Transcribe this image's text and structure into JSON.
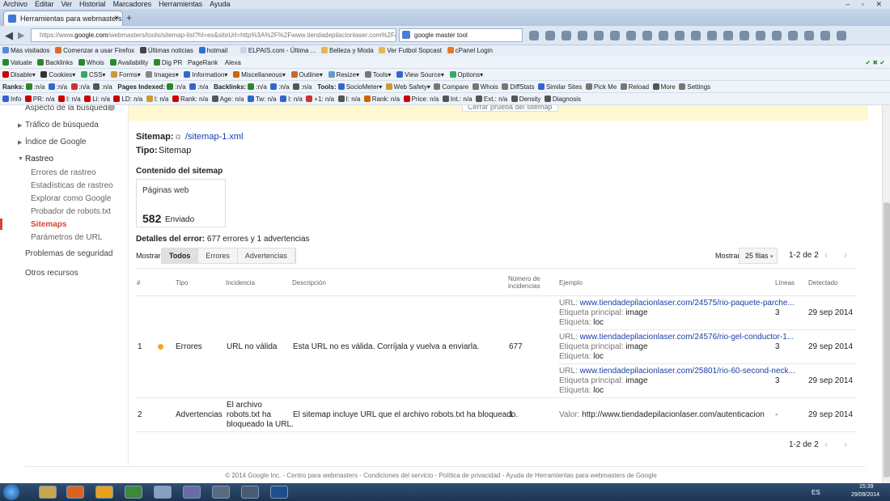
{
  "menubar": [
    "Archivo",
    "Editar",
    "Ver",
    "Historial",
    "Marcadores",
    "Herramientas",
    "Ayuda"
  ],
  "tab": {
    "title": "Herramientas para webmasters de ...",
    "close": "×",
    "new": "+"
  },
  "url": {
    "prefix": "https://www.",
    "host": "google.com",
    "path": "/webmasters/tools/sitemap-list?hl=es&siteUrl=http%3A%2F%2Fwww.tiendadepilacionlaser.com%2F#MA"
  },
  "search": {
    "value": "google master tool"
  },
  "bookmarks": [
    "Más visitados",
    "Comenzar a usar Firefox",
    "Últimas noticias",
    "hotmail",
    "ELPAIS.com - Última ...",
    "Belleza y Moda",
    "Ver Futbol Sopcast",
    "cPanel Login"
  ],
  "toolbar1": [
    "Valuate",
    "Backlinks",
    "Whois",
    "Availability",
    "Dig PR",
    "PageRank",
    "Alexa"
  ],
  "toolbar2": [
    "Disable",
    "Cookies",
    "CSS",
    "Forms",
    "Images",
    "Information",
    "Miscellaneous",
    "Outline",
    "Resize",
    "Tools",
    "View Source",
    "Options"
  ],
  "toolbar3": {
    "ranks": "Ranks:",
    "na": "n/a",
    "pages": "Pages Indexed:",
    "backlinks": "Backlinks:",
    "tools": "Tools:",
    "items": [
      "SocioMeter",
      "Web Safety",
      "Compare",
      "Whois",
      "DiffStats",
      "Similar Sites",
      "Pick Me",
      "Reload",
      "More",
      "Settings"
    ]
  },
  "toolbar4": [
    "Info",
    "PR: n/a",
    "I: n/a",
    "Li: n/a",
    "LD: n/a",
    "I: n/a",
    "Rank: n/a",
    "Age: n/a",
    "Tw: n/a",
    "I: n/a",
    "+1: n/a",
    "I: n/a",
    "Rank: n/a",
    "Price: n/a",
    "Int.: n/a",
    "Ext.: n/a",
    "Density",
    "Diagnosis"
  ],
  "banner": {
    "text": "Cerrar prueba del sitemap"
  },
  "sidebar": {
    "items": [
      {
        "label": "Aspecto de la búsqueda"
      },
      {
        "label": "Tráfico de búsqueda"
      },
      {
        "label": "Índice de Google"
      },
      {
        "label": "Rastreo"
      },
      {
        "label": "Errores de rastreo"
      },
      {
        "label": "Estadísticas de rastreo"
      },
      {
        "label": "Explorar como Google"
      },
      {
        "label": "Probador de robots.txt"
      },
      {
        "label": "Sitemaps"
      },
      {
        "label": "Parámetros de URL"
      },
      {
        "label": "Problemas de seguridad"
      },
      {
        "label": "Otros recursos"
      }
    ]
  },
  "main": {
    "sitemap_label": "Sitemap:",
    "sitemap_value": "/sitemap-1.xml",
    "tipo_label": "Tipo:",
    "tipo_value": "Sitemap",
    "contenido_title": "Contenido del sitemap",
    "paginas_label": "Páginas web",
    "enviado_count": "582",
    "enviado_label": "Enviado",
    "detalles_label": "Detalles del error:",
    "detalles_value": "677 errores y 1 advertencias",
    "mostrar": "Mostrar:",
    "filters": [
      "Todos",
      "Errores",
      "Advertencias"
    ],
    "mostrar_right": "Mostrar",
    "rows_per_page": "25 filas",
    "pagination": "1-2 de 2",
    "columns": [
      "#",
      "Tipo",
      "Incidencia",
      "Descripción",
      "Número de incidencias",
      "Ejemplo",
      "Líneas",
      "Detectado"
    ],
    "rows": [
      {
        "num": "1",
        "tipo": "Errores",
        "incidencia": "URL no válida",
        "descripcion": "Esta URL no es válida. Corríjala y vuelva a enviarla.",
        "numero": "677",
        "examples": [
          {
            "url": "www.tiendadepilacionlaser.com/24575/rio-paquete-parche...",
            "etiqueta": "image",
            "etiqueta2": "loc",
            "lineas": "3",
            "fecha": "29 sep 2014"
          },
          {
            "url": "www.tiendadepilacionlaser.com/24576/rio-gel-conductor-1...",
            "etiqueta": "image",
            "etiqueta2": "loc",
            "lineas": "3",
            "fecha": "29 sep 2014"
          },
          {
            "url": "www.tiendadepilacionlaser.com/25801/rio-60-second-neck...",
            "etiqueta": "image",
            "etiqueta2": "loc",
            "lineas": "3",
            "fecha": "29 sep 2014"
          }
        ]
      },
      {
        "num": "2",
        "tipo": "Advertencias",
        "incidencia": [
          "El archivo",
          "robots.txt ha",
          "bloqueado la URL."
        ],
        "descripcion": "El sitemap incluye URL que el archivo robots.txt ha bloqueado.",
        "numero": "1",
        "valor_label": "Valor:",
        "valor": "http://www.tiendadepilacionlaser.com/autenticacion",
        "lineas": "-",
        "fecha": "29 sep 2014"
      }
    ],
    "url_label": "URL:",
    "etiqueta_principal": "Etiqueta principal:",
    "etiqueta": "Etiqueta:"
  },
  "footer": "© 2014 Google Inc. - Centro para webmasters - Condiciones del servicio - Política de privacidad - Ayuda de Herramientas para webmasters de Google",
  "taskbar": {
    "lang": "ES",
    "time": "15:39",
    "date": "29/09/2014"
  }
}
